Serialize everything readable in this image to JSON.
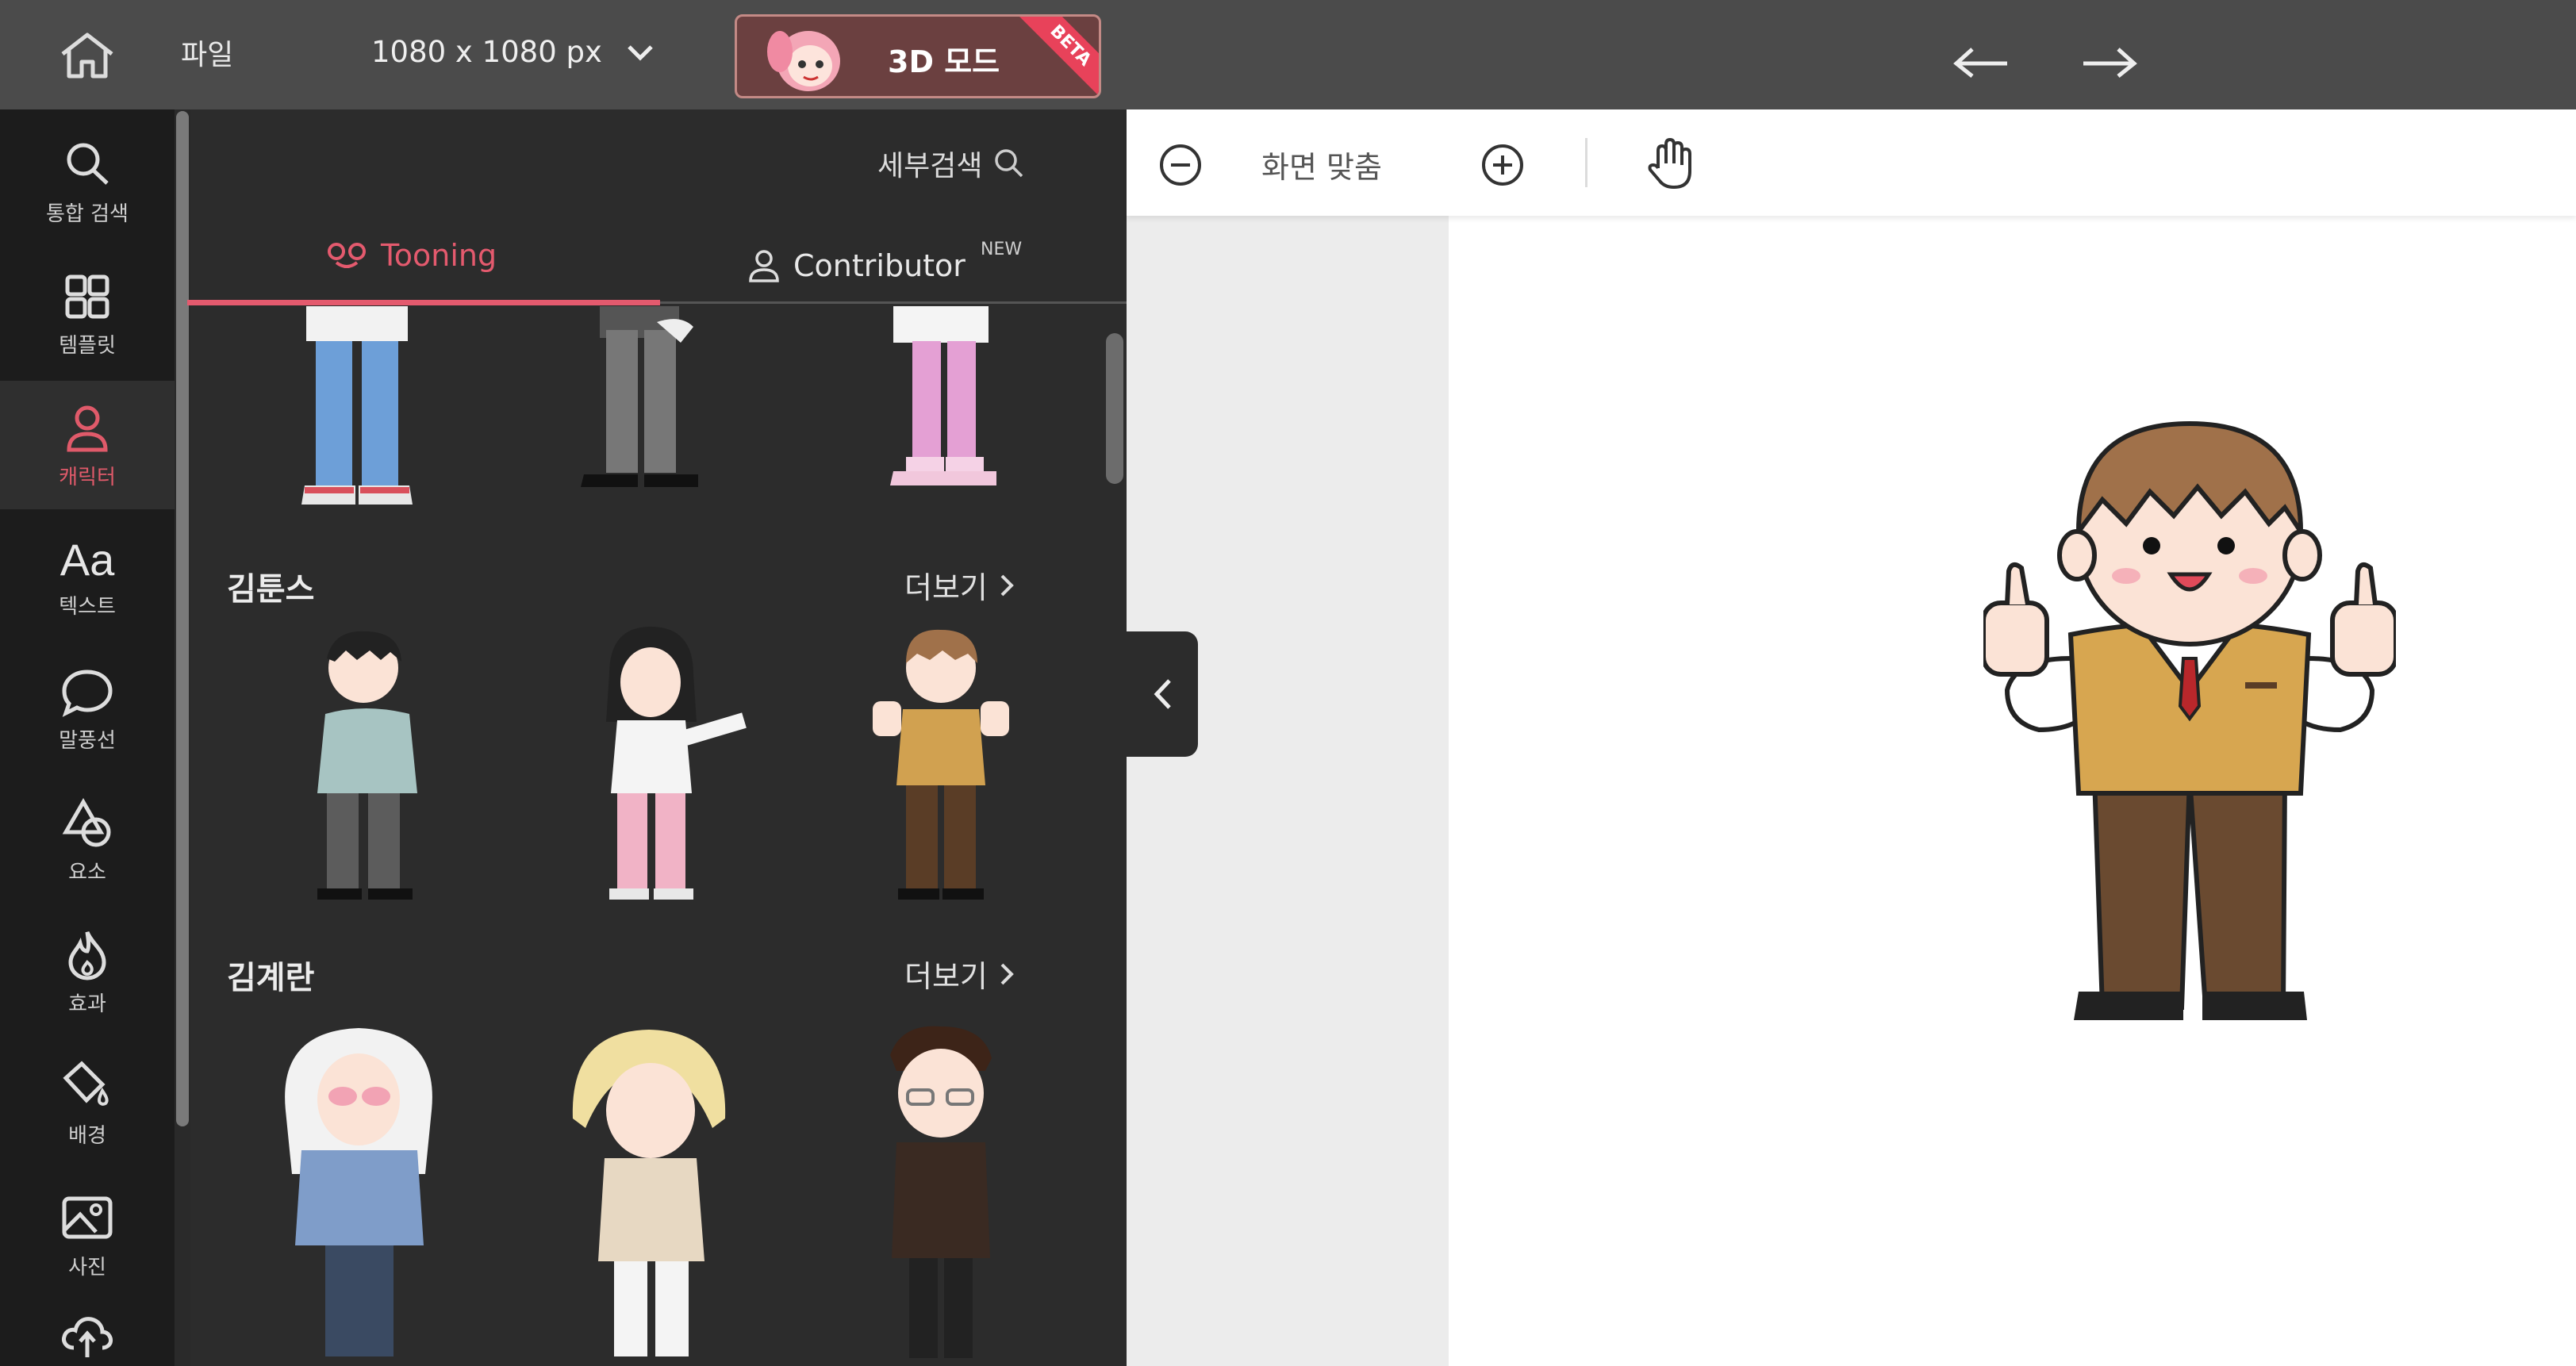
{
  "topbar": {
    "file_label": "파일",
    "size_label": "1080 x 1080 px",
    "mode3d_label": "3D 모드",
    "beta_badge": "BETA"
  },
  "rail": {
    "items": [
      {
        "label": "통합 검색",
        "icon": "search-icon"
      },
      {
        "label": "템플릿",
        "icon": "template-grid-icon"
      },
      {
        "label": "캐릭터",
        "icon": "character-icon",
        "active": true
      },
      {
        "label": "텍스트",
        "icon": "text-icon"
      },
      {
        "label": "말풍선",
        "icon": "speech-bubble-icon"
      },
      {
        "label": "요소",
        "icon": "shapes-icon"
      },
      {
        "label": "효과",
        "icon": "effect-fire-icon"
      },
      {
        "label": "배경",
        "icon": "paint-bucket-icon"
      },
      {
        "label": "사진",
        "icon": "photo-icon"
      },
      {
        "label": "",
        "icon": "upload-cloud-icon"
      }
    ]
  },
  "panel": {
    "detail_search": "세부검색",
    "tabs": [
      {
        "label": "Tooning",
        "active": true
      },
      {
        "label": "Contributor",
        "badge": "NEW"
      }
    ],
    "sections": [
      {
        "title": "김툰스",
        "more": "더보기"
      },
      {
        "title": "김계란",
        "more": "더보기"
      }
    ]
  },
  "workspace": {
    "zoom_label": "화면 맞춤"
  },
  "colors": {
    "accent": "#e45a6e",
    "topbar": "#4b4b4b",
    "panel": "#2c2c2c",
    "rail": "#1c1c1c"
  }
}
